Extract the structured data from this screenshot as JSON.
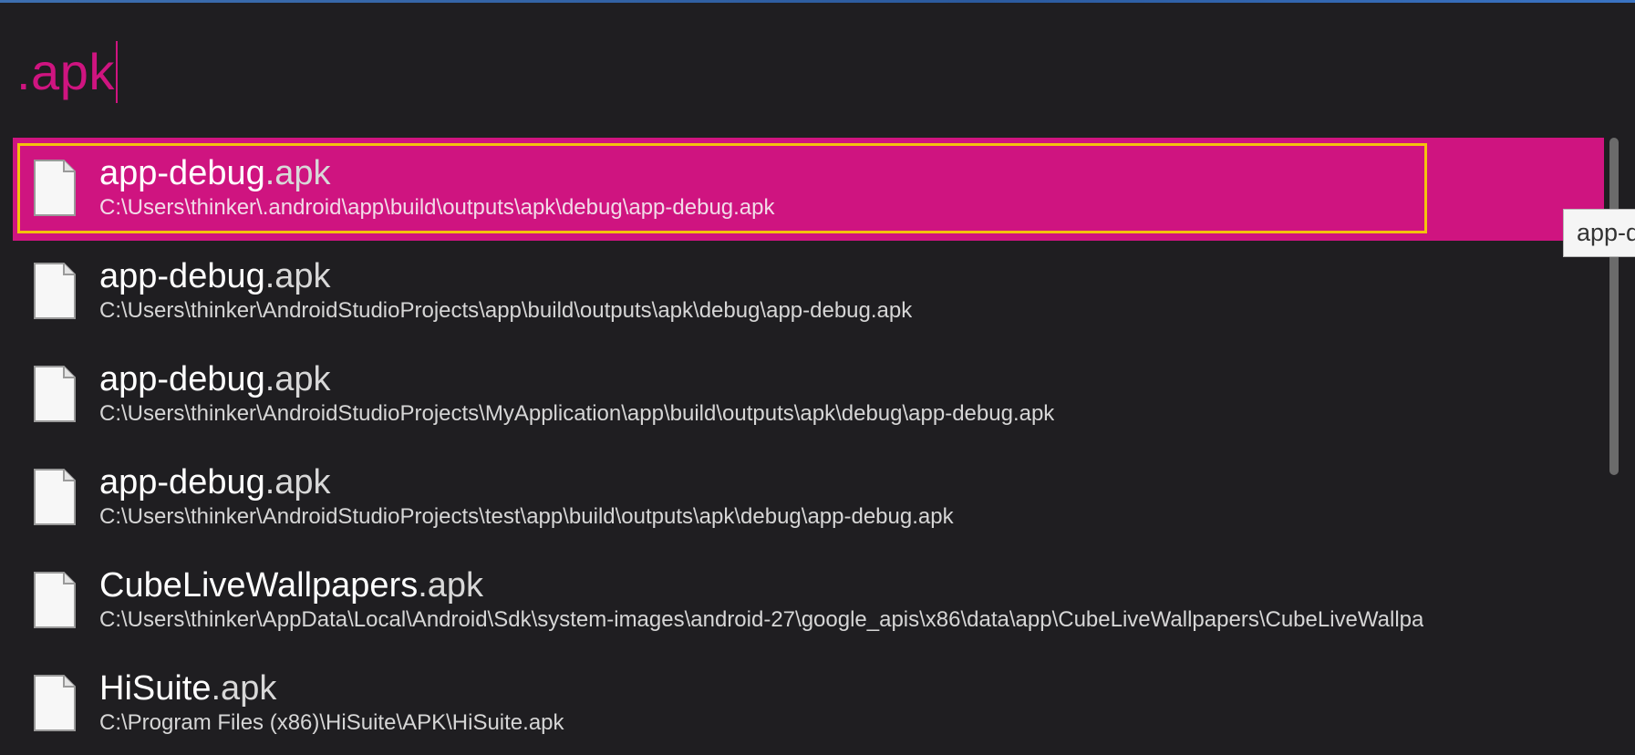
{
  "search": {
    "query": ".apk"
  },
  "results": [
    {
      "name": "app-debug",
      "ext": ".apk",
      "path": "C:\\Users\\thinker\\.android\\app\\build\\outputs\\apk\\debug\\app-debug.apk",
      "selected": true
    },
    {
      "name": "app-debug",
      "ext": ".apk",
      "path": "C:\\Users\\thinker\\AndroidStudioProjects\\app\\build\\outputs\\apk\\debug\\app-debug.apk"
    },
    {
      "name": "app-debug",
      "ext": ".apk",
      "path": "C:\\Users\\thinker\\AndroidStudioProjects\\MyApplication\\app\\build\\outputs\\apk\\debug\\app-debug.apk"
    },
    {
      "name": "app-debug",
      "ext": ".apk",
      "path": "C:\\Users\\thinker\\AndroidStudioProjects\\test\\app\\build\\outputs\\apk\\debug\\app-debug.apk"
    },
    {
      "name": "CubeLiveWallpapers",
      "ext": ".apk",
      "path": "C:\\Users\\thinker\\AppData\\Local\\Android\\Sdk\\system-images\\android-27\\google_apis\\x86\\data\\app\\CubeLiveWallpapers\\CubeLiveWallpa"
    },
    {
      "name": "HiSuite",
      "ext": ".apk",
      "path": "C:\\Program Files (x86)\\HiSuite\\APK\\HiSuite.apk"
    }
  ],
  "tooltip": {
    "text": "app-d"
  },
  "icons": {
    "file": "file-icon"
  },
  "colors": {
    "accent": "#cf1480",
    "focus": "#f4c20d",
    "background": "#1f1e21"
  }
}
